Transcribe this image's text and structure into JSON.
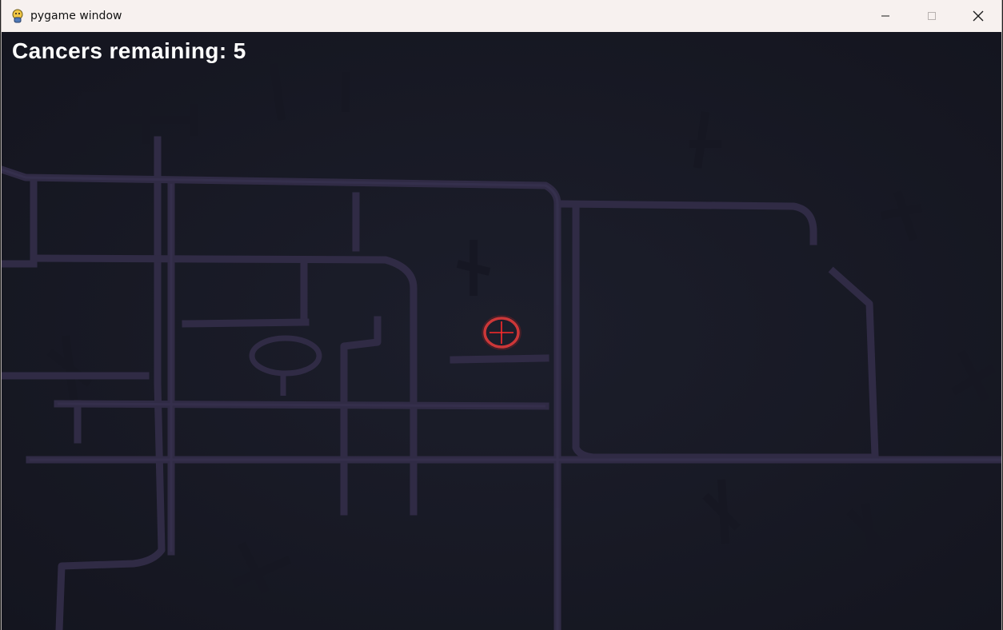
{
  "window": {
    "title": "pygame window",
    "controls": {
      "minimize_icon": "minimize-icon",
      "maximize_icon": "maximize-icon",
      "close_icon": "close-icon"
    }
  },
  "hud": {
    "label": "Cancers remaining: 5"
  },
  "colors": {
    "background": "#191b27",
    "paths": "#302b45",
    "crosshair": "#e03a3a",
    "hud_text": "#ffffff"
  }
}
